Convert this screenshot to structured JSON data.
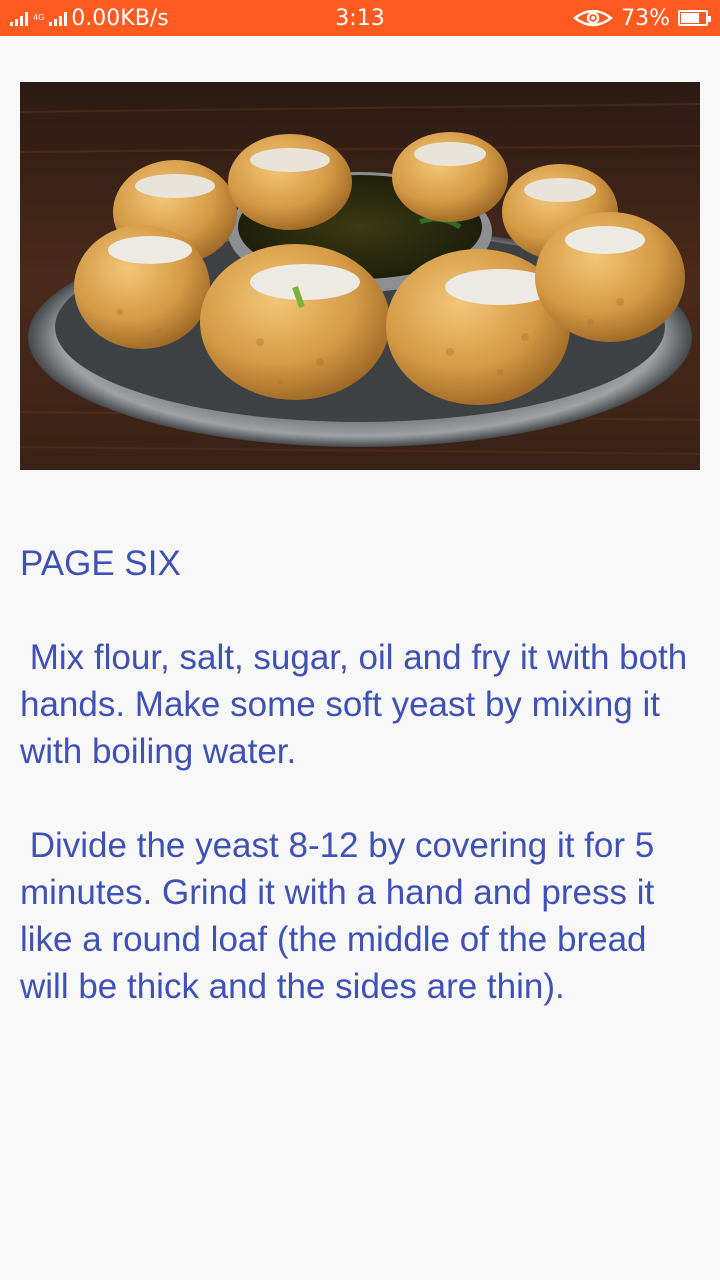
{
  "status_bar": {
    "network_type": "4G",
    "data_rate": "0.00KB/s",
    "time": "3:13",
    "battery_percent": "73%",
    "battery_level": 0.73,
    "background_color": "#ff5a1f"
  },
  "hero_image": {
    "icon": "pani-puri-plate-image"
  },
  "article": {
    "title": "PAGE SIX",
    "paragraphs": [
      " Mix flour, salt, sugar, oil and fry it with both hands. Make some soft yeast by mixing it with boiling water.",
      " Divide the yeast 8-12 by covering it for 5 minutes. Grind it with a hand and press it like a round loaf (the middle of the bread will be thick and the sides are thin)."
    ],
    "text_color": "#3f51b5"
  }
}
